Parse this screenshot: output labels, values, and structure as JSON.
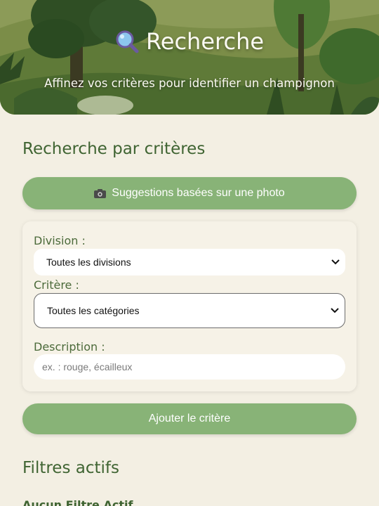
{
  "header": {
    "title": "Recherche",
    "subtitle": "Affinez vos critères pour identifier un champignon",
    "title_icon": "magnifier-icon"
  },
  "search_section": {
    "title": "Recherche par critères",
    "photo_button_label": "Suggestions basées sur une photo",
    "photo_button_icon": "camera-icon"
  },
  "criteria_form": {
    "division_label": "Division :",
    "division_value": "Toutes les divisions",
    "criterion_label": "Critère :",
    "criterion_value": "Toutes les catégories",
    "description_label": "Description :",
    "description_placeholder": "ex. : rouge, écailleux",
    "description_value": ""
  },
  "add_button_label": "Ajouter le critère",
  "active_filters": {
    "title": "Filtres actifs",
    "empty_text": "Aucun Filtre Actif"
  },
  "colors": {
    "background": "#f3efe3",
    "accent_button": "#88b377",
    "heading": "#3f6432"
  }
}
